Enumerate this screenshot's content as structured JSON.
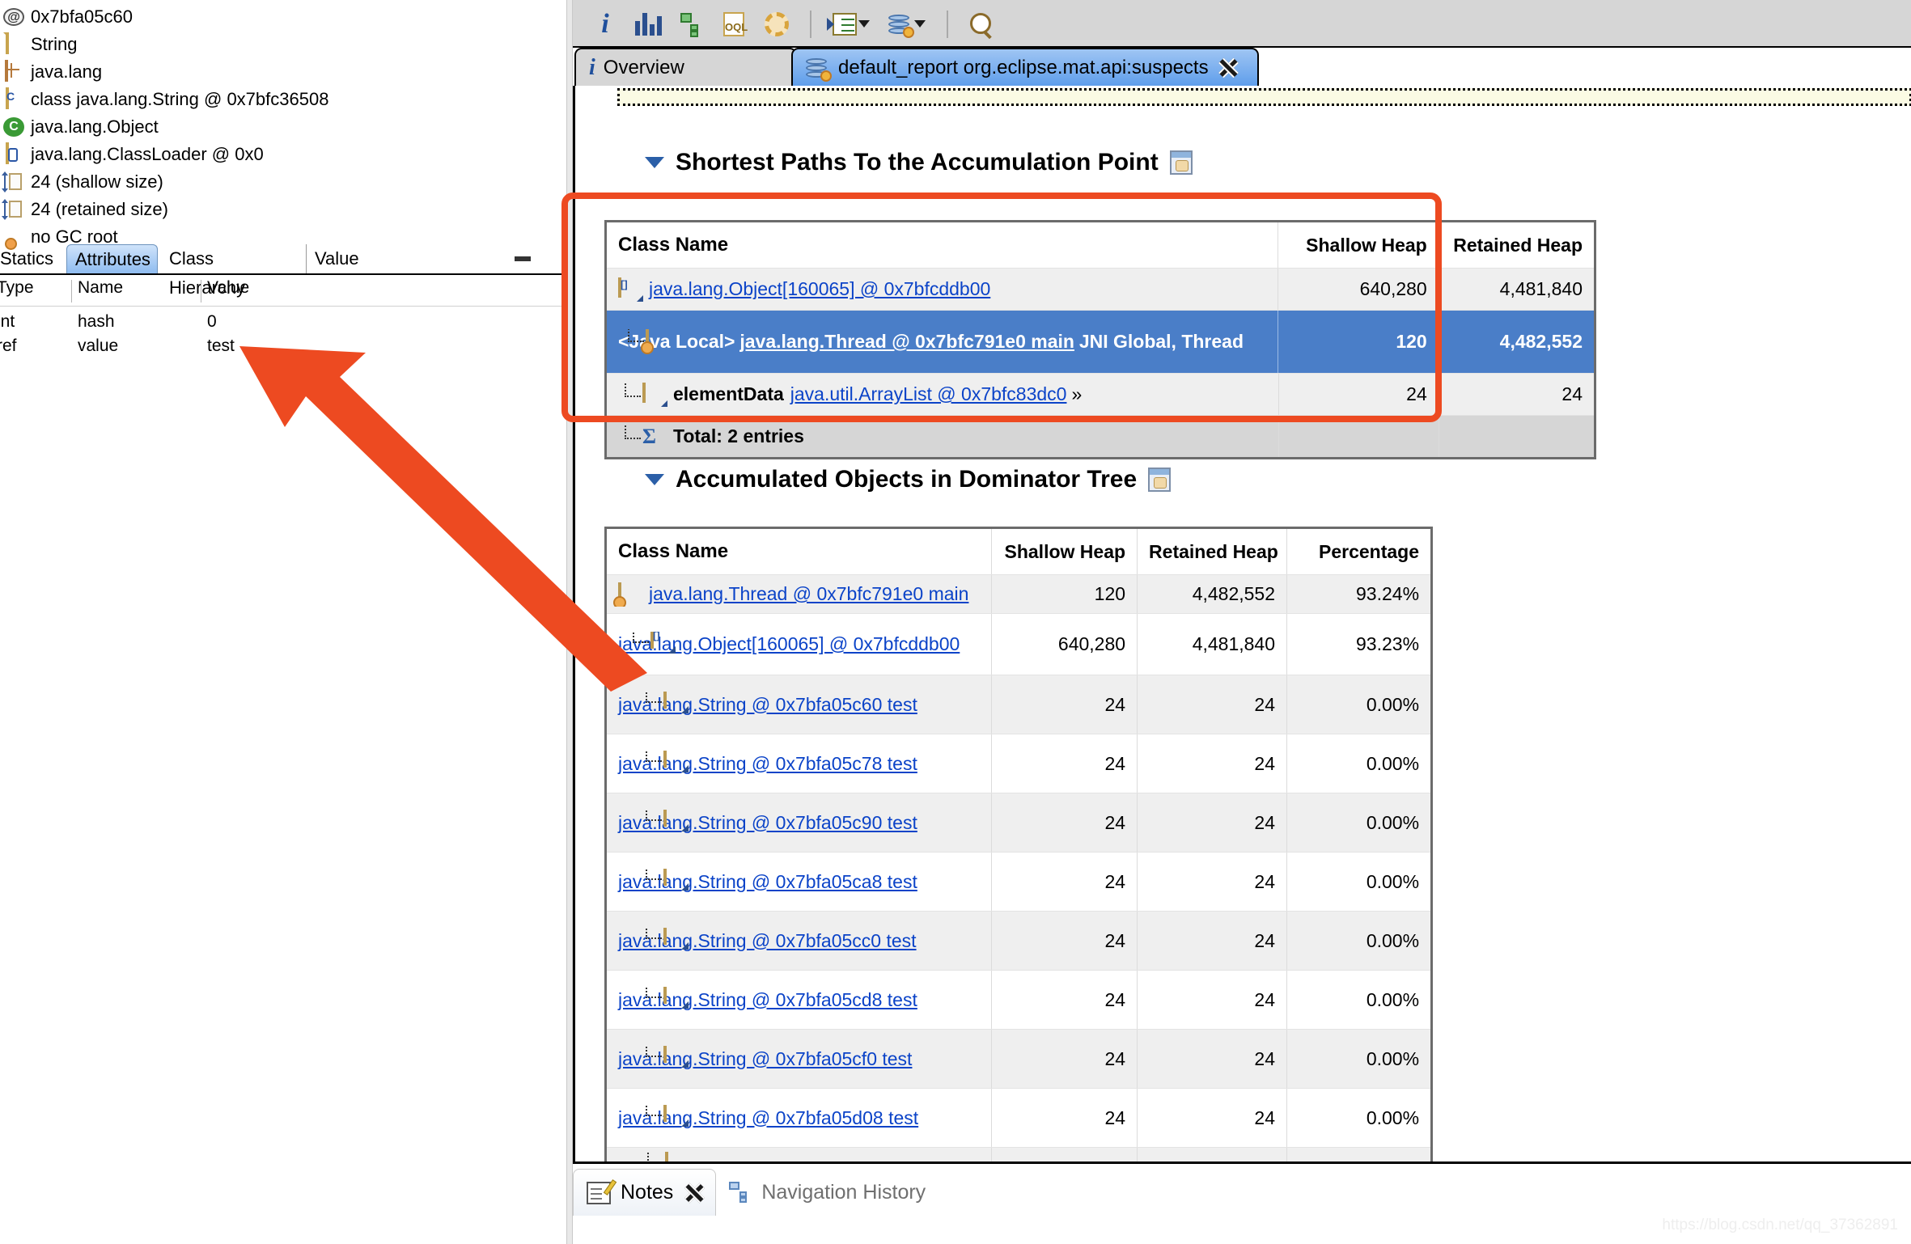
{
  "colors": {
    "annotation_red": "#ED4A21",
    "selected_row_blue": "#4a7ec8",
    "link_blue": "#0b43c8",
    "active_tab_blue": "#5f9eeb"
  },
  "inspector": {
    "items": [
      {
        "icon": "at-sign-icon",
        "label": "0x7bfa05c60"
      },
      {
        "icon": "document-icon",
        "label": "String"
      },
      {
        "icon": "package-icon",
        "label": "java.lang"
      },
      {
        "icon": "class-file-icon",
        "label": "class java.lang.String @ 0x7bfc36508"
      },
      {
        "icon": "superclass-icon",
        "label": "java.lang.Object"
      },
      {
        "icon": "classloader-icon",
        "label": "java.lang.ClassLoader @ 0x0"
      },
      {
        "icon": "shallow-size-icon",
        "label": "24 (shallow size)"
      },
      {
        "icon": "retained-size-icon",
        "label": "24 (retained size)"
      },
      {
        "icon": "gc-root-icon",
        "label": "no GC root"
      }
    ],
    "tabs": [
      {
        "label": "Statics",
        "selected": false
      },
      {
        "label": "Attributes",
        "selected": true
      },
      {
        "label": "Class Hierarchy",
        "selected": false
      },
      {
        "label": "Value",
        "selected": false
      }
    ],
    "minimize_glyph": "▬",
    "attributes_table": {
      "columns": [
        "Type",
        "Name",
        "Value"
      ],
      "rows": [
        {
          "type": "int",
          "name": "hash",
          "value": "0"
        },
        {
          "type": "ref",
          "name": "value",
          "value": "test"
        }
      ]
    }
  },
  "toolbar": {
    "buttons": [
      {
        "name": "overview-info-button",
        "icon": "info-icon"
      },
      {
        "name": "histogram-button",
        "icon": "histogram-icon"
      },
      {
        "name": "dominator-tree-button",
        "icon": "dominator-tree-icon"
      },
      {
        "name": "oql-button",
        "icon": "oql-icon"
      },
      {
        "name": "calculate-button",
        "icon": "gear-icon"
      },
      {
        "name": "query-browser-button",
        "icon": "query-list-icon",
        "has_dropdown": true
      },
      {
        "name": "report-button",
        "icon": "heap-report-icon",
        "has_dropdown": true
      },
      {
        "name": "find-button",
        "icon": "search-icon"
      }
    ]
  },
  "editor_tabs": [
    {
      "label": "Overview",
      "icon": "info-icon",
      "active": false,
      "closable": false
    },
    {
      "label": "default_report  org.eclipse.mat.api:suspects",
      "icon": "heap-report-icon",
      "active": true,
      "closable": true
    }
  ],
  "sections": [
    {
      "title": "Shortest Paths To the Accumulation Point",
      "expanded": true,
      "table": {
        "columns": [
          "Class Name",
          "Shallow Heap",
          "Retained Heap"
        ],
        "rows": [
          {
            "icon": "array-object-icon",
            "indent": 0,
            "class_name": "java.lang.Object[160065] @ 0x7bfcddb00",
            "prefix": "",
            "suffix": "",
            "shallow_heap": "640,280",
            "retained_heap": "4,481,840",
            "selected": false,
            "two_line": false
          },
          {
            "icon": "thread-object-icon",
            "indent": 1,
            "class_name": "java.lang.Thread @ 0x7bfc791e0 main",
            "prefix": "<Java Local>",
            "suffix": "JNI Global, Thread",
            "shallow_heap": "120",
            "retained_heap": "4,482,552",
            "selected": true,
            "two_line": true
          },
          {
            "icon": "document-icon",
            "indent": 1,
            "class_name": "java.util.ArrayList @ 0x7bfc83dc0",
            "prefix": "elementData",
            "suffix": "»",
            "shallow_heap": "24",
            "retained_heap": "24",
            "selected": false,
            "two_line": false
          },
          {
            "icon": "sum-icon",
            "indent": 1,
            "class_name": "",
            "prefix": "Total: 2 entries",
            "suffix": "",
            "shallow_heap": "",
            "retained_heap": "",
            "selected": false,
            "total_row": true,
            "two_line": false
          }
        ]
      }
    },
    {
      "title": "Accumulated Objects in Dominator Tree",
      "expanded": true,
      "table": {
        "columns": [
          "Class Name",
          "Shallow Heap",
          "Retained Heap",
          "Percentage"
        ],
        "rows": [
          {
            "icon": "thread-object-icon",
            "indent": 0,
            "class_name": "java.lang.Thread @ 0x7bfc791e0 main",
            "shallow_heap": "120",
            "retained_heap": "4,482,552",
            "percentage": "93.24%",
            "two_line": false
          },
          {
            "icon": "array-object-icon",
            "indent": 1,
            "class_name": "java.lang.Object[160065] @ 0x7bfcddb00",
            "shallow_heap": "640,280",
            "retained_heap": "4,481,840",
            "percentage": "93.23%",
            "two_line": true
          },
          {
            "icon": "document-icon",
            "indent": 2,
            "class_name": "java.lang.String @ 0x7bfa05c60 test",
            "shallow_heap": "24",
            "retained_heap": "24",
            "percentage": "0.00%",
            "two_line": true
          },
          {
            "icon": "document-icon",
            "indent": 2,
            "class_name": "java.lang.String @ 0x7bfa05c78 test",
            "shallow_heap": "24",
            "retained_heap": "24",
            "percentage": "0.00%",
            "two_line": true
          },
          {
            "icon": "document-icon",
            "indent": 2,
            "class_name": "java.lang.String @ 0x7bfa05c90 test",
            "shallow_heap": "24",
            "retained_heap": "24",
            "percentage": "0.00%",
            "two_line": true
          },
          {
            "icon": "document-icon",
            "indent": 2,
            "class_name": "java.lang.String @ 0x7bfa05ca8 test",
            "shallow_heap": "24",
            "retained_heap": "24",
            "percentage": "0.00%",
            "two_line": true
          },
          {
            "icon": "document-icon",
            "indent": 2,
            "class_name": "java.lang.String @ 0x7bfa05cc0 test",
            "shallow_heap": "24",
            "retained_heap": "24",
            "percentage": "0.00%",
            "two_line": true
          },
          {
            "icon": "document-icon",
            "indent": 2,
            "class_name": "java.lang.String @ 0x7bfa05cd8 test",
            "shallow_heap": "24",
            "retained_heap": "24",
            "percentage": "0.00%",
            "two_line": true
          },
          {
            "icon": "document-icon",
            "indent": 2,
            "class_name": "java.lang.String @ 0x7bfa05cf0 test",
            "shallow_heap": "24",
            "retained_heap": "24",
            "percentage": "0.00%",
            "two_line": true
          },
          {
            "icon": "document-icon",
            "indent": 2,
            "class_name": "java.lang.String @ 0x7bfa05d08 test",
            "shallow_heap": "24",
            "retained_heap": "24",
            "percentage": "0.00%",
            "two_line": true
          },
          {
            "icon": "document-icon",
            "indent": 2,
            "class_name": "",
            "shallow_heap": "",
            "retained_heap": "",
            "percentage": "",
            "two_line": false
          }
        ]
      }
    }
  ],
  "bottom_view": {
    "tabs": [
      {
        "label": "Notes",
        "icon": "notes-icon",
        "active": true,
        "closable": true
      },
      {
        "label": "Navigation History",
        "icon": "navigation-history-icon",
        "active": false,
        "closable": false
      }
    ]
  },
  "watermark": "https://blog.csdn.net/qq_37362891"
}
